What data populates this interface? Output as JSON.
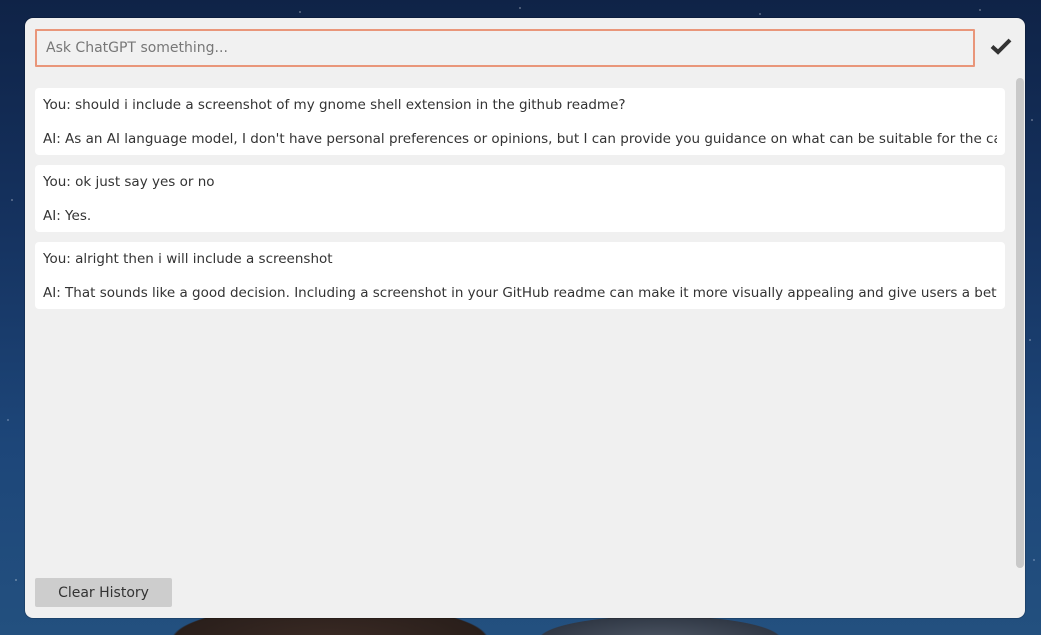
{
  "prompt": {
    "placeholder": "Ask ChatGPT something...",
    "value": ""
  },
  "send_icon": "checkmark-icon",
  "history": [
    {
      "user": "You: should i include a screenshot of my gnome shell extension in the github readme?",
      "ai": "AI: As an AI language model, I don't have personal preferences or opinions, but I can provide you guidance on what can be suitable for the case."
    },
    {
      "user": "You: ok just say yes or no",
      "ai": "AI: Yes."
    },
    {
      "user": "You: alright then i will include a screenshot",
      "ai": "AI: That sounds like a good decision. Including a screenshot in your GitHub readme can make it more visually appealing and give users a better"
    }
  ],
  "footer": {
    "clear_label": "Clear History"
  },
  "colors": {
    "accent_border": "#e9967a",
    "panel_bg": "#f0f0f0",
    "message_bg": "#ffffff",
    "text": "#333333"
  }
}
